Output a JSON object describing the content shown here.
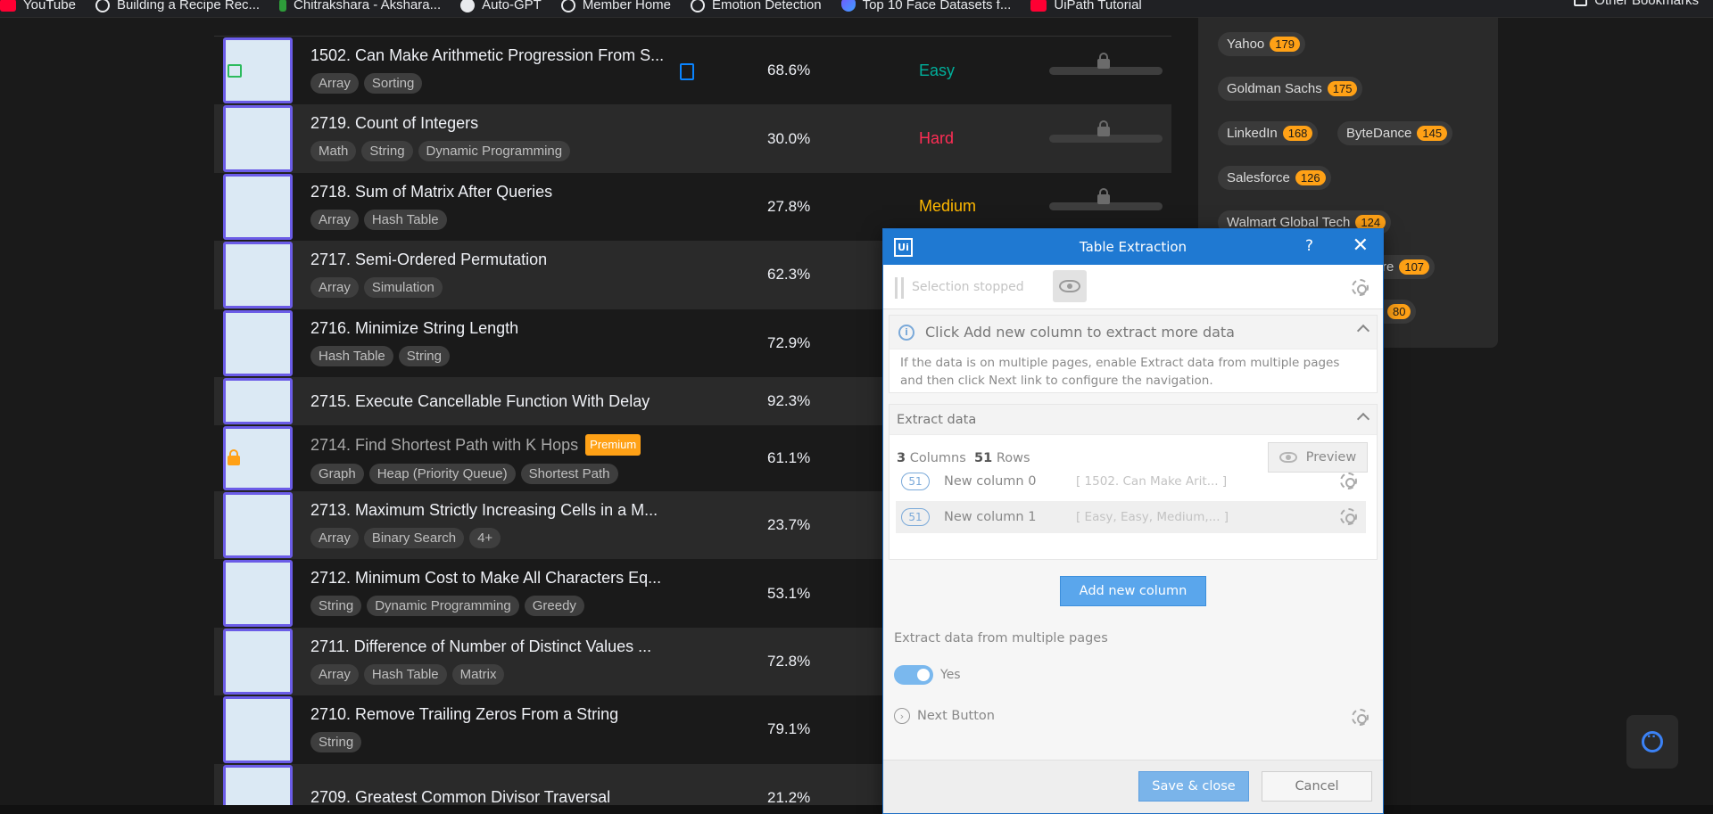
{
  "bookmarks": {
    "items": [
      {
        "label": "YouTube",
        "icon": "youtube-icon"
      },
      {
        "label": "Building a Recipe Rec...",
        "icon": "globe-icon"
      },
      {
        "label": "Chitrakshara - Akshara...",
        "icon": "app-icon"
      },
      {
        "label": "Auto-GPT",
        "icon": "github-icon"
      },
      {
        "label": "Member Home",
        "icon": "globe-icon"
      },
      {
        "label": "Emotion Detection",
        "icon": "globe-icon"
      },
      {
        "label": "Top 10 Face Datasets f...",
        "icon": "shield-icon"
      },
      {
        "label": "UiPath Tutorial",
        "icon": "youtube-icon"
      }
    ],
    "other": "Other Bookmarks"
  },
  "problems": [
    {
      "title": "1502. Can Make Arithmetic Progression From S...",
      "tags": [
        "Array",
        "Sorting"
      ],
      "acceptance": "68.6%",
      "difficulty": "Easy",
      "status": "calendar-icon",
      "solution": true,
      "premium": false
    },
    {
      "title": "2719. Count of Integers",
      "tags": [
        "Math",
        "String",
        "Dynamic Programming"
      ],
      "acceptance": "30.0%",
      "difficulty": "Hard",
      "status": "",
      "solution": false,
      "premium": false
    },
    {
      "title": "2718. Sum of Matrix After Queries",
      "tags": [
        "Array",
        "Hash Table"
      ],
      "acceptance": "27.8%",
      "difficulty": "Medium",
      "status": "",
      "solution": false,
      "premium": false
    },
    {
      "title": "2717. Semi-Ordered Permutation",
      "tags": [
        "Array",
        "Simulation"
      ],
      "acceptance": "62.3%",
      "difficulty": "",
      "status": "",
      "solution": false,
      "premium": false
    },
    {
      "title": "2716. Minimize String Length",
      "tags": [
        "Hash Table",
        "String"
      ],
      "acceptance": "72.9%",
      "difficulty": "",
      "status": "",
      "solution": false,
      "premium": false
    },
    {
      "title": "2715. Execute Cancellable Function With Delay",
      "tags": [],
      "acceptance": "92.3%",
      "difficulty": "",
      "status": "",
      "solution": false,
      "premium": false
    },
    {
      "title": "2714. Find Shortest Path with K Hops",
      "tags": [
        "Graph",
        "Heap (Priority Queue)",
        "Shortest Path"
      ],
      "acceptance": "61.1%",
      "difficulty": "",
      "status": "lock-icon",
      "solution": false,
      "premium": true
    },
    {
      "title": "2713. Maximum Strictly Increasing Cells in a M...",
      "tags": [
        "Array",
        "Binary Search",
        "4+"
      ],
      "acceptance": "23.7%",
      "difficulty": "",
      "status": "",
      "solution": false,
      "premium": false
    },
    {
      "title": "2712. Minimum Cost to Make All Characters Eq...",
      "tags": [
        "String",
        "Dynamic Programming",
        "Greedy"
      ],
      "acceptance": "53.1%",
      "difficulty": "",
      "status": "",
      "solution": false,
      "premium": false
    },
    {
      "title": "2711. Difference of Number of Distinct Values ...",
      "tags": [
        "Array",
        "Hash Table",
        "Matrix"
      ],
      "acceptance": "72.8%",
      "difficulty": "",
      "status": "",
      "solution": false,
      "premium": false
    },
    {
      "title": "2710. Remove Trailing Zeros From a String",
      "tags": [
        "String"
      ],
      "acceptance": "79.1%",
      "difficulty": "",
      "status": "",
      "solution": false,
      "premium": false
    },
    {
      "title": "2709. Greatest Common Divisor Traversal",
      "tags": [],
      "acceptance": "21.2%",
      "difficulty": "",
      "status": "",
      "solution": false,
      "premium": false
    }
  ],
  "premium_label": "Premium",
  "companies": [
    {
      "name": "Yahoo",
      "count": "179"
    },
    {
      "name": "Goldman Sachs",
      "count": "175"
    },
    {
      "name": "LinkedIn",
      "count": "168"
    },
    {
      "name": "ByteDance",
      "count": "145"
    },
    {
      "name": "Salesforce",
      "count": "126"
    },
    {
      "name": "Walmart Global Tech",
      "count": "124"
    },
    {
      "name": "re",
      "count": "107"
    },
    {
      "name": "",
      "count": "80"
    }
  ],
  "dialog": {
    "title": "Table Extraction",
    "help": "?",
    "close": "✕",
    "logo": "Ui",
    "selection_status": "Selection stopped",
    "info_title": "Click Add new column to extract more data",
    "info_text": "If the data is on multiple pages, enable Extract data from multiple pages and then click Next link to configure the navigation.",
    "extract_heading": "Extract data",
    "columns_count": "3",
    "columns_label": "Columns",
    "rows_count": "51",
    "rows_label": "Rows",
    "preview_label": "Preview",
    "columns": [
      {
        "count": "51",
        "name": "New column 0",
        "preview": "[ 1502. Can Make Arit... ]"
      },
      {
        "count": "51",
        "name": "New column 1",
        "preview": "[ Easy, Easy, Medium,... ]"
      }
    ],
    "add_column_label": "Add new column",
    "multi_pages_label": "Extract data from multiple pages",
    "multi_pages_value": "Yes",
    "next_button_label": "Next Button",
    "save_label": "Save & close",
    "cancel_label": "Cancel"
  },
  "colors": {
    "easy": "#00af9b",
    "medium": "#ffb800",
    "hard": "#ff2d55",
    "dialog_accent": "#1f79d2",
    "company_count": "#ffa116"
  }
}
